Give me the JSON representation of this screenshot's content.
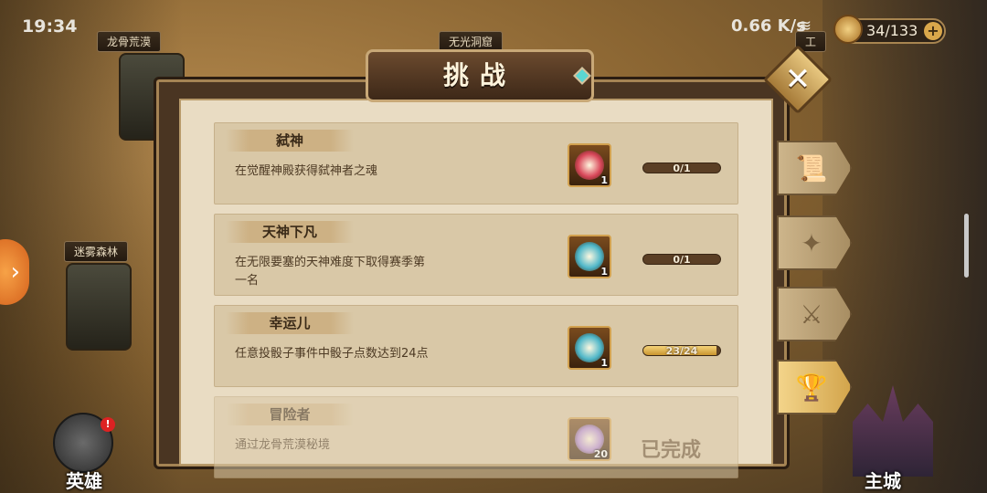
{
  "status_bar": {
    "time": "19:34",
    "net_speed": "0.66 K/s",
    "stamina": "34/133",
    "stamina_plus": "+"
  },
  "map": {
    "labels": [
      "龙骨荒漠",
      "无光洞窟",
      "迷雾森林",
      "工"
    ],
    "left_arrow": "›"
  },
  "bottom": {
    "hero_label": "英雄",
    "hero_badge": "!",
    "city_label": "主城"
  },
  "dialog": {
    "title": "挑战",
    "close": "✕",
    "challenges": [
      {
        "name": "弑神",
        "desc": "在觉醒神殿获得弑神者之魂",
        "reward_count": "1",
        "progress_text": "0/1",
        "progress": 0.0,
        "completed": false,
        "reward_color": "#d9485a"
      },
      {
        "name": "天神下凡",
        "desc": "在无限要塞的天神难度下取得赛季第一名",
        "reward_count": "1",
        "progress_text": "0/1",
        "progress": 0.0,
        "completed": false,
        "reward_color": "#4fb7c9"
      },
      {
        "name": "幸运儿",
        "desc": "任意投骰子事件中骰子点数达到24点",
        "reward_count": "1",
        "progress_text": "23/24",
        "progress": 0.958,
        "completed": false,
        "reward_color": "#4fb7c9"
      },
      {
        "name": "冒险者",
        "desc": "通过龙骨荒漠秘境",
        "reward_count": "20",
        "progress_text": "",
        "progress": 1.0,
        "completed": true,
        "completed_label": "已完成",
        "reward_color": "#b58cd6"
      }
    ]
  },
  "side_tabs": [
    {
      "icon": "scroll-icon",
      "glyph": "📜",
      "active": false
    },
    {
      "icon": "book-icon",
      "glyph": "✦",
      "active": false
    },
    {
      "icon": "crossed-swords-icon",
      "glyph": "⚔",
      "active": false
    },
    {
      "icon": "trophy-icon",
      "glyph": "🏆",
      "active": true
    }
  ]
}
